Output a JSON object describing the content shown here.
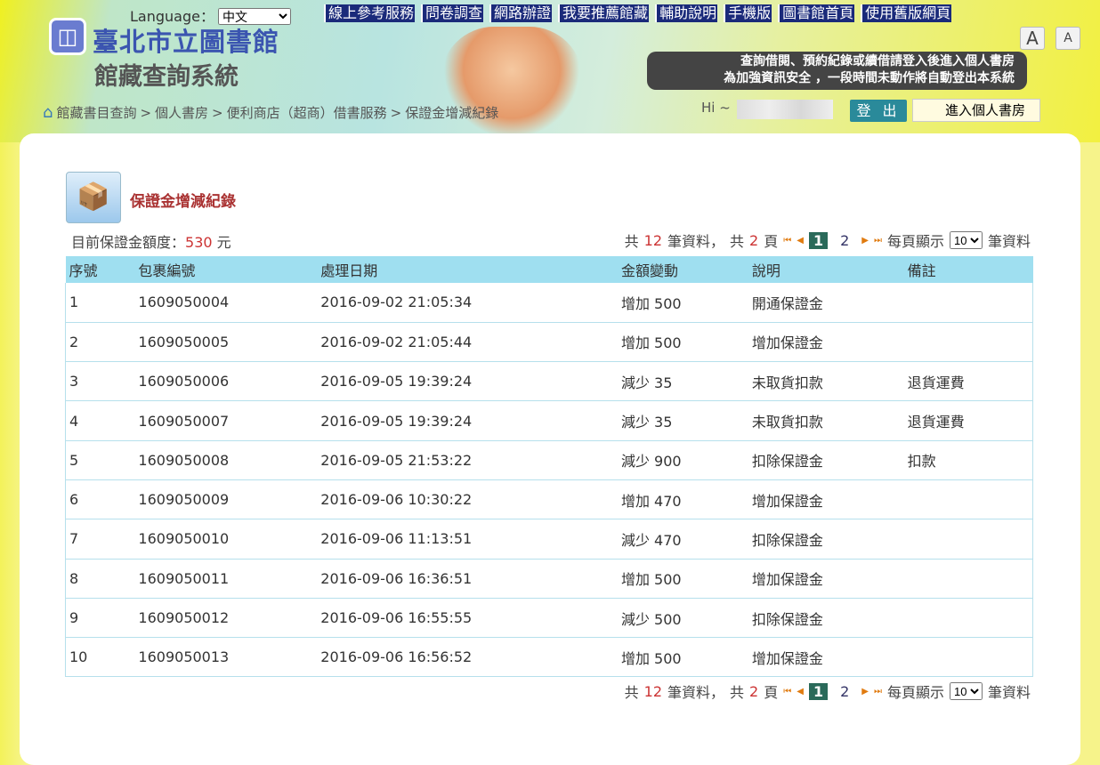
{
  "header": {
    "language_label": "Language：",
    "language_value": "中文",
    "top_links": [
      "線上參考服務",
      "問卷調查",
      "網路辦證",
      "我要推薦館藏",
      "輔助說明",
      "手機版",
      "圖書館首頁",
      "使用舊版網頁"
    ],
    "title": "臺北市立圖書館",
    "subtitle": "館藏查詢系統",
    "font_large": "A",
    "font_small": "A",
    "notice_line1": "查詢借閱、預約紀錄或續借請登入後進入個人書房",
    "notice_line2": "為加強資訊安全 ，一段時間未動作將自動登出本系統",
    "greeting": "Hi ~",
    "logout": "登 出",
    "my_library": "進入個人書房"
  },
  "breadcrumb": [
    "館藏書目查詢",
    "個人書房",
    "便利商店（超商）借書服務",
    "保證金增減紀錄"
  ],
  "page": {
    "title": "保證金增減紀錄",
    "balance_label": "目前保證金額度：",
    "balance_value": "530",
    "balance_unit": "元"
  },
  "pager": {
    "total_prefix": "共",
    "total_count": "12",
    "total_suffix": "筆資料，",
    "pages_prefix": "共",
    "pages_count": "2",
    "pages_suffix": "頁",
    "pages": [
      "1",
      "2"
    ],
    "current": "1",
    "per_page_label": "每頁顯示",
    "per_page": "10",
    "per_page_suffix": "筆資料"
  },
  "table": {
    "headers": [
      "序號",
      "包裹編號",
      "處理日期",
      "金額變動",
      "說明",
      "備註"
    ],
    "rows": [
      [
        "1",
        "1609050004",
        "2016-09-02 21:05:34",
        "增加 500",
        "開通保證金",
        ""
      ],
      [
        "2",
        "1609050005",
        "2016-09-02 21:05:44",
        "增加 500",
        "增加保證金",
        ""
      ],
      [
        "3",
        "1609050006",
        "2016-09-05 19:39:24",
        "減少 35",
        "未取貨扣款",
        "退貨運費"
      ],
      [
        "4",
        "1609050007",
        "2016-09-05 19:39:24",
        "減少 35",
        "未取貨扣款",
        "退貨運費"
      ],
      [
        "5",
        "1609050008",
        "2016-09-05 21:53:22",
        "減少 900",
        "扣除保證金",
        "扣款"
      ],
      [
        "6",
        "1609050009",
        "2016-09-06 10:30:22",
        "增加 470",
        "增加保證金",
        ""
      ],
      [
        "7",
        "1609050010",
        "2016-09-06 11:13:51",
        "減少 470",
        "扣除保證金",
        ""
      ],
      [
        "8",
        "1609050011",
        "2016-09-06 16:36:51",
        "增加 500",
        "增加保證金",
        ""
      ],
      [
        "9",
        "1609050012",
        "2016-09-06 16:55:55",
        "減少 500",
        "扣除保證金",
        ""
      ],
      [
        "10",
        "1609050013",
        "2016-09-06 16:56:52",
        "增加 500",
        "增加保證金",
        ""
      ]
    ]
  }
}
